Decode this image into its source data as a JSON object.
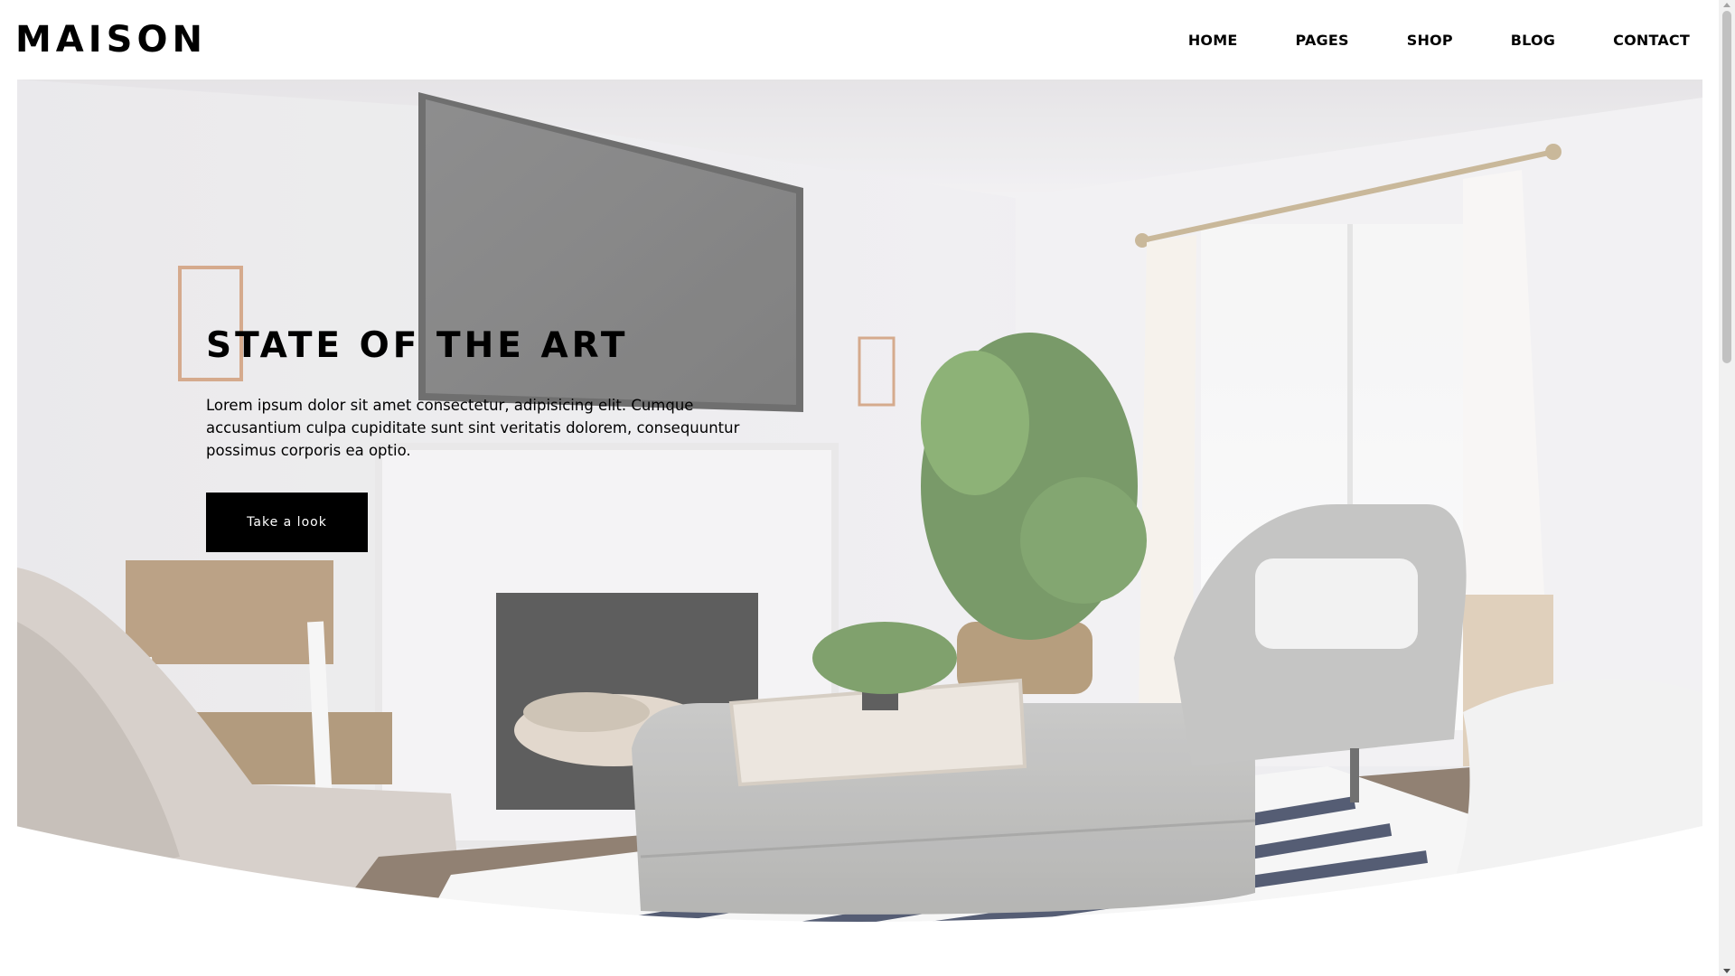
{
  "brand": {
    "logo": "MAISON"
  },
  "nav": {
    "items": [
      "HOME",
      "PAGES",
      "SHOP",
      "BLOG",
      "CONTACT"
    ]
  },
  "hero": {
    "title": "STATE OF THE ART",
    "text": "Lorem ipsum dolor sit amet consectetur, adipisicing elit. Cumque accusantium culpa cupiditate sunt sint veritatis dolorem, consequuntur possimus corporis ea optio.",
    "button_label": "Take a look",
    "image_icon": "living-room-photo"
  },
  "colors": {
    "accent": "#000000",
    "background": "#ffffff"
  }
}
